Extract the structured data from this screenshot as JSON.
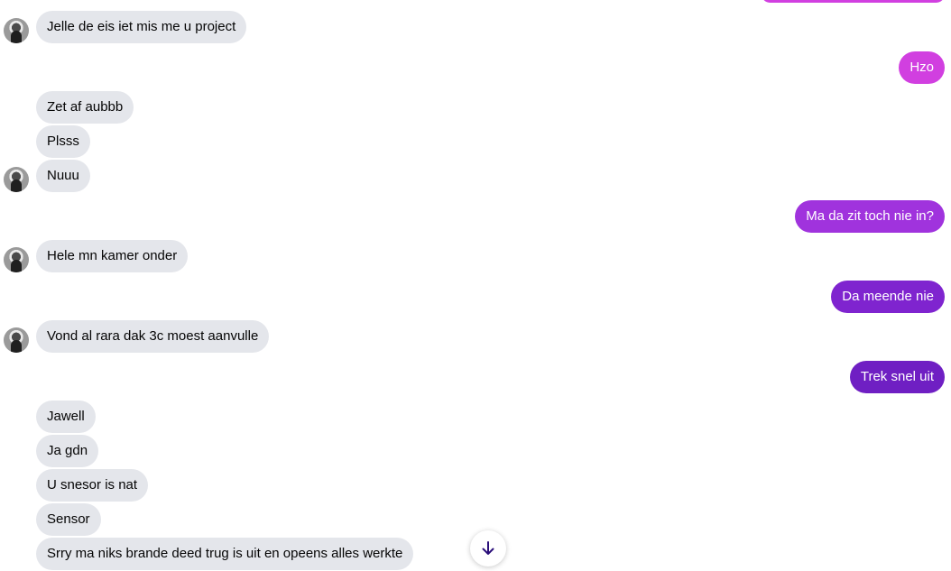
{
  "colors": {
    "incoming_bg": "#e4e6eb",
    "outgoing_top": "#d13fe0",
    "outgoing_mid": "#a033dd",
    "outgoing_low": "#7f24cf",
    "outgoing_bottom": "#6f1fc3",
    "scroll_icon": "#2b0f7a"
  },
  "messages": {
    "m1": "Jelle de eis iet mis me u project",
    "m2": "Hzo",
    "m3": "Zet af aubbb",
    "m4": "Plsss",
    "m5": "Nuuu",
    "m6": "Ma da zit toch nie in?",
    "m7": "Hele mn kamer onder",
    "m8": "Da meende nie",
    "m9": "Vond al rara dak 3c moest aanvulle",
    "m10": "Trek snel uit",
    "m11": "Jawell",
    "m12": "Ja gdn",
    "m13": "U snesor is nat",
    "m14": "Sensor",
    "m15": "Srry ma niks brande deed trug is uit en opeens alles werkte"
  },
  "icons": {
    "scroll_down": "arrow-down-icon",
    "avatar": "contact-avatar"
  }
}
